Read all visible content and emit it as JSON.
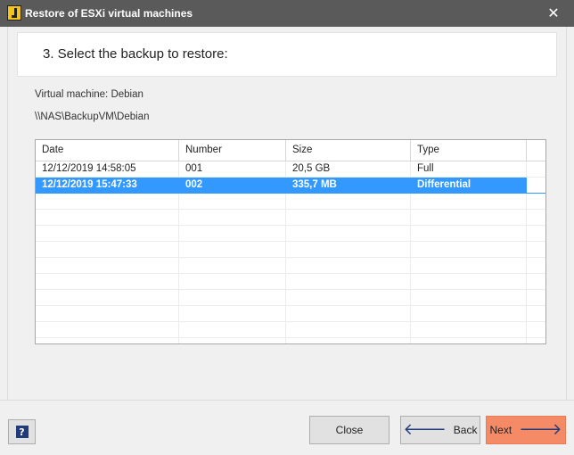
{
  "window": {
    "title": "Restore of ESXi virtual machines",
    "close_glyph": "✕",
    "icon": "app-logo-icon"
  },
  "step": {
    "title": "3. Select the backup to restore:"
  },
  "vm": {
    "label": "Virtual machine: Debian",
    "path": "\\\\NAS\\BackupVM\\Debian"
  },
  "table": {
    "columns": [
      "Date",
      "Number",
      "Size",
      "Type"
    ],
    "rows": [
      {
        "date": "12/12/2019 14:58:05",
        "number": "001",
        "size": "20,5 GB",
        "type": "Full"
      },
      {
        "date": "12/12/2019 15:47:33",
        "number": "002",
        "size": "335,7 MB",
        "type": "Differential"
      }
    ],
    "selected_row": 1
  },
  "footer": {
    "help_label": "?",
    "close_label": "Close",
    "back_label": "Back",
    "next_label": "Next",
    "back_arrow": "🡐",
    "next_arrow": "🡒"
  },
  "colors": {
    "selection": "#3399ff",
    "next_button": "#f58a67",
    "titlebar": "#5a5a5a"
  }
}
